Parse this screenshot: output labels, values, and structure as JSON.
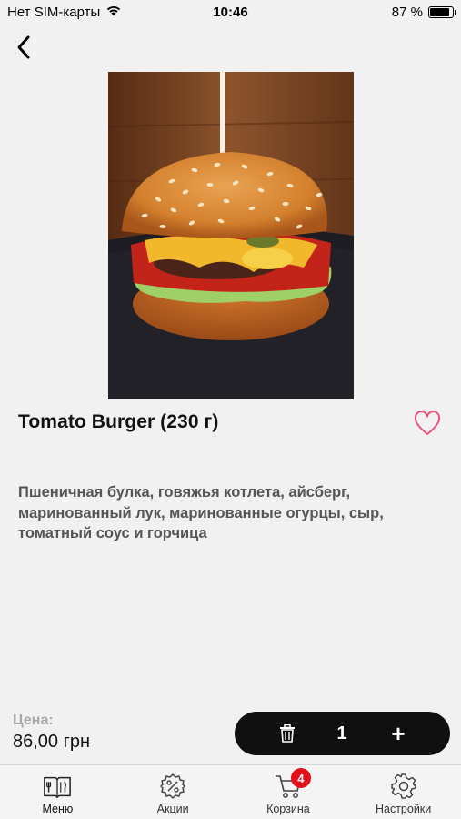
{
  "status_bar": {
    "carrier": "Нет SIM-карты",
    "time": "10:46",
    "battery_percent": "87 %",
    "battery_level": 0.87
  },
  "product": {
    "title": "Tomato Burger (230 г)",
    "description": "Пшеничная булка, говяжья котлета, айсберг, маринованный лук, маринованные огурцы, сыр, томатный соус и горчица",
    "price_label": "Цена:",
    "price": "86,00 грн",
    "quantity": "1",
    "favorite": false
  },
  "cart_control": {
    "plus_label": "+"
  },
  "tab_bar": {
    "tabs": [
      {
        "label": "Меню",
        "icon": "menu-book-icon",
        "active": true
      },
      {
        "label": "Акции",
        "icon": "discount-gear-icon",
        "active": false
      },
      {
        "label": "Корзина",
        "icon": "cart-icon",
        "active": false,
        "badge": "4"
      },
      {
        "label": "Настройки",
        "icon": "settings-gear-icon",
        "active": false
      }
    ]
  },
  "colors": {
    "background": "#f1f1f1",
    "accent_dark": "#101010",
    "badge_red": "#e3101a",
    "heart_pink": "#e8557a"
  }
}
